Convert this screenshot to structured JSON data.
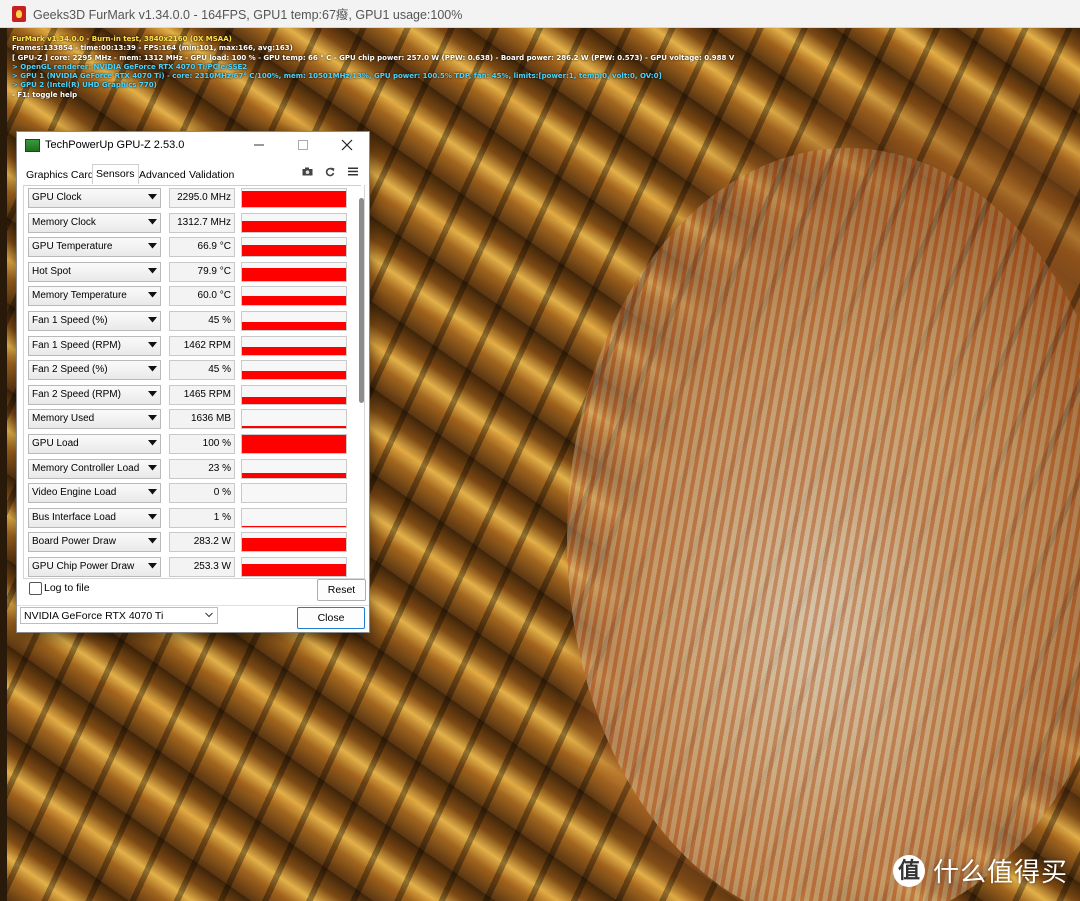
{
  "furmark": {
    "window_title": "Geeks3D FurMark v1.34.0.0 - 164FPS, GPU1 temp:67癈, GPU1 usage:100%",
    "overlay_lines": [
      {
        "text": "FurMark v1.34.0.0 - Burn-in test, 3840x2160 (0X MSAA)",
        "color": "#ffe44a"
      },
      {
        "text": "Frames:133854 - time:00:13:39 - FPS:164 (min:101, max:166, avg:163)",
        "color": "#ffffff"
      },
      {
        "text": "[ GPU-Z ] core: 2295 MHz - mem: 1312 MHz - GPU load: 100 % - GPU temp: 66 ° C - GPU chip power: 257.0 W (PPW: 0.638) - Board power: 286.2 W (PPW: 0.573) - GPU voltage: 0.988 V",
        "color": "#ffffff"
      },
      {
        "text": "> OpenGL renderer: NVIDIA GeForce RTX 4070 Ti/PCIe/SSE2",
        "color": "#48d4ff"
      },
      {
        "text": "> GPU 1 (NVIDIA GeForce RTX 4070 Ti) - core: 2310MHz/67° C/100%, mem: 10501MHz/13%, GPU power: 100.5% TDP, fan: 45%, limits:[power:1, temp:0, volt:0, OV:0]",
        "color": "#48d4ff"
      },
      {
        "text": "> GPU 2 (Intel(R) UHD Graphics 770)",
        "color": "#48d4ff"
      },
      {
        "text": "- F1: toggle help",
        "color": "#ffffff"
      }
    ]
  },
  "gpuz": {
    "title": "TechPowerUp GPU-Z 2.53.0",
    "tabs": [
      "Graphics Card",
      "Sensors",
      "Advanced",
      "Validation"
    ],
    "active_tab": "Sensors",
    "sensors": [
      {
        "name": "GPU Clock",
        "value": "2295.0 MHz",
        "level": 0.9
      },
      {
        "name": "Memory Clock",
        "value": "1312.7 MHz",
        "level": 0.6
      },
      {
        "name": "GPU Temperature",
        "value": "66.9 °C",
        "level": 0.62
      },
      {
        "name": "Hot Spot",
        "value": "79.9 °C",
        "level": 0.7
      },
      {
        "name": "Memory Temperature",
        "value": "60.0 °C",
        "level": 0.55
      },
      {
        "name": "Fan 1 Speed (%)",
        "value": "45 %",
        "level": 0.45
      },
      {
        "name": "Fan 1 Speed (RPM)",
        "value": "1462 RPM",
        "level": 0.4
      },
      {
        "name": "Fan 2 Speed (%)",
        "value": "45 %",
        "level": 0.45
      },
      {
        "name": "Fan 2 Speed (RPM)",
        "value": "1465 RPM",
        "level": 0.4
      },
      {
        "name": "Memory Used",
        "value": "1636 MB",
        "level": 0.15
      },
      {
        "name": "GPU Load",
        "value": "100 %",
        "level": 1.0
      },
      {
        "name": "Memory Controller Load",
        "value": "23 %",
        "level": 0.23
      },
      {
        "name": "Video Engine Load",
        "value": "0 %",
        "level": 0.0
      },
      {
        "name": "Bus Interface Load",
        "value": "1 %",
        "level": 0.02
      },
      {
        "name": "Board Power Draw",
        "value": "283.2 W",
        "level": 0.72
      },
      {
        "name": "GPU Chip Power Draw",
        "value": "253.3 W",
        "level": 0.65
      }
    ],
    "log_to_file_label": "Log to file",
    "reset_label": "Reset",
    "gpu_select_value": "NVIDIA GeForce RTX 4070 Ti",
    "close_label": "Close",
    "graph_color": "#ff0000"
  },
  "watermark": {
    "logo_text": "值",
    "text": "什么值得买"
  }
}
